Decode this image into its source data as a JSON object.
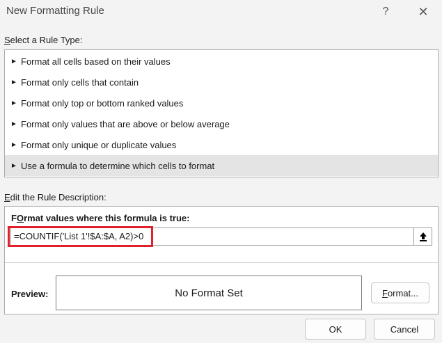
{
  "window": {
    "title": "New Formatting Rule",
    "help_glyph": "?",
    "close_glyph": "✕"
  },
  "rule_type": {
    "label_prefix": "",
    "label_accel": "S",
    "label_rest": "elect a Rule Type:",
    "arrow_glyph": "►",
    "selected_index": 5,
    "items": [
      {
        "label": "Format all cells based on their values"
      },
      {
        "label": "Format only cells that contain"
      },
      {
        "label": "Format only top or bottom ranked values"
      },
      {
        "label": "Format only values that are above or below average"
      },
      {
        "label": "Format only unique or duplicate values"
      },
      {
        "label": "Use a formula to determine which cells to format"
      }
    ]
  },
  "description": {
    "label_accel": "E",
    "label_rest": "dit the Rule Description:",
    "formula_heading_accel": "O",
    "formula_heading_pre": "F",
    "formula_heading_rest": "rmat values where this formula is true:",
    "formula_value": "=COUNTIF('List 1'!$A:$A, A2)>0",
    "preview_label": "Preview:",
    "preview_text": "No Format Set",
    "format_button_accel": "F",
    "format_button_rest": "ormat..."
  },
  "buttons": {
    "ok": "OK",
    "cancel": "Cancel"
  },
  "colors": {
    "highlight": "#e0202a",
    "selected_row": "#e4e4e4"
  }
}
